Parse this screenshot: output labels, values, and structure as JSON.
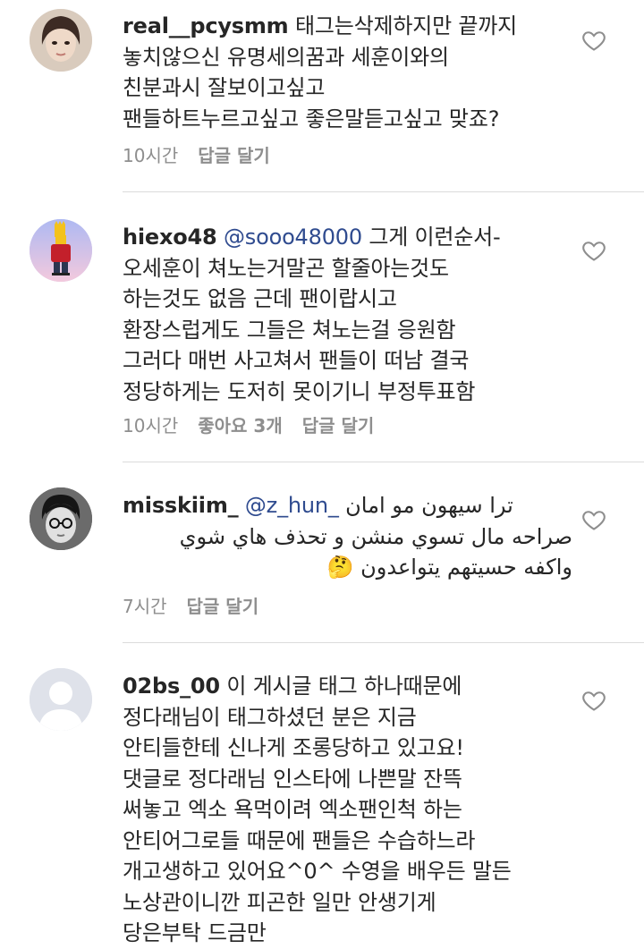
{
  "comments": [
    {
      "username": "real__pcysmm",
      "mention": "",
      "lines": [
        "태그는삭제하지만 끝까지",
        "놓치않으신 유명세의꿈과 세훈이와의",
        "친분과시 잘보이고싶고",
        "팬들하트누르고싶고 좋은말듣고싶고 맞죠?"
      ],
      "time": "10시간",
      "likes": "",
      "reply": "답글 달기"
    },
    {
      "username": "hiexo48",
      "mention": "@sooo48000",
      "lines": [
        "그게 이런순서-",
        "오세훈이 쳐노는거말곤 할줄아는것도",
        "하는것도 없음 근데 팬이랍시고",
        "환장스럽게도 그들은 쳐노는걸 응원함",
        "그러다 매번 사고쳐서 팬들이 떠남 결국",
        "정당하게는 도저히 못이기니 부정투표함"
      ],
      "time": "10시간",
      "likes": "좋아요 3개",
      "reply": "답글 달기"
    },
    {
      "username": "misskiim_",
      "mention": "@z_hun_",
      "lines": [
        "ترا سيهون مو امان",
        "صراحه مال تسوي منشن و تحذف هاي شوي",
        "واكفه حسيتهم يتواعدون 🤔"
      ],
      "time": "7시간",
      "likes": "",
      "reply": "답글 달기"
    },
    {
      "username": "02bs_00",
      "mention": "",
      "lines": [
        "이 게시글 태그 하나때문에",
        "정다래님이 태그하셨던 분은 지금",
        "안티들한테 신나게 조롱당하고 있고요!",
        "댓글로 정다래님 인스타에 나쁜말 잔뜩",
        "써놓고 엑소 욕먹이려 엑소팬인척 하는",
        "안티어그로들 때문에 팬들은 수습하느라",
        "개고생하고 있어요^0^ 수영을 배우든 말든",
        "노상관이니깐 피곤한 일만 안생기게",
        "당은부탁 드금만"
      ],
      "time": "",
      "likes": "",
      "reply": ""
    }
  ],
  "icons": {
    "like": "heart-outline-icon",
    "avatar_default": "default-avatar-icon"
  },
  "colors": {
    "text": "#262626",
    "meta": "#8e8e8e",
    "mention": "#2f4b8f",
    "divider": "#dbdbdb"
  }
}
